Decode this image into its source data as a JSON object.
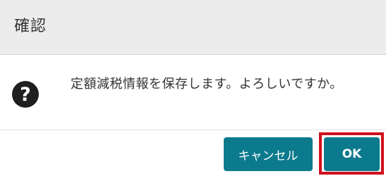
{
  "dialog": {
    "title": "確認",
    "icon": "question-circle-icon",
    "message": "定額減税情報を保存します。よろしいですか。",
    "buttons": {
      "cancel_label": "キャンセル",
      "ok_label": "OK"
    },
    "colors": {
      "header_bg": "#ececec",
      "button_bg": "#0c7a8d",
      "highlight": "#d0101c"
    }
  }
}
